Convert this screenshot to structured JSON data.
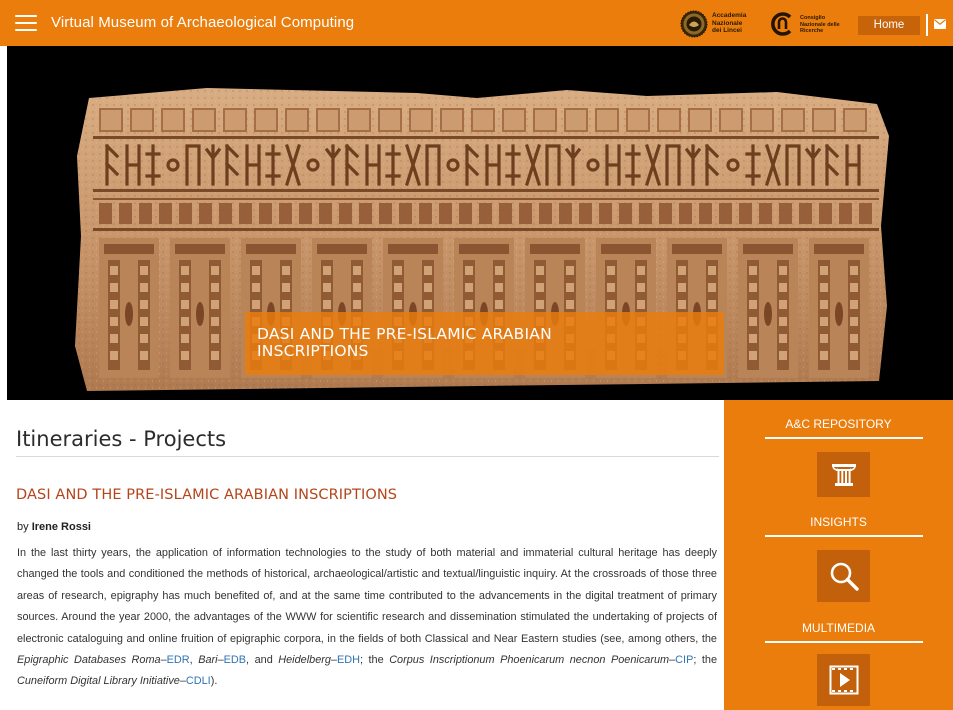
{
  "header": {
    "menu_icon": "hamburger-menu-icon",
    "title": "Virtual Museum of Archaeological Computing",
    "lincei_logo_text": [
      "Accademia",
      "Nazionale",
      "dei Lincei"
    ],
    "cnr_logo_text": [
      "Consiglio",
      "Nazionale delle",
      "Ricerche"
    ],
    "home_label": "Home",
    "mail_icon": "envelope-icon"
  },
  "hero": {
    "image": "carved stone slab with South Arabian inscription",
    "caption_lines": [
      "DASI AND THE PRE-ISLAMIC ARABIAN",
      "INSCRIPTIONS"
    ]
  },
  "main": {
    "page_title": "Itineraries - Projects",
    "article_title": "DASI AND THE PRE-ISLAMIC ARABIAN INSCRIPTIONS",
    "byline_prefix": "by",
    "author": "Irene Rossi",
    "body": {
      "t1": "In the last thirty years, the application of information technologies to the study of both material and immaterial cultural heritage has deeply changed the tools and conditioned the methods of historical, archaeological/artistic and textual/linguistic inquiry. At the crossroads of those three areas of research, epigraphy has much benefited of, and at the same time contributed to the advancements in the digital treatment of primary sources. Around the year 2000, the advantages of the WWW for scientific research and dissemination stimulated the undertaking of projects of electronic cataloguing and online fruition of epigraphic corpora, in the fields of both Classical and Near Eastern studies (see, among others, the ",
      "i1": "Epigraphic Databases Roma",
      "s1": "–",
      "l1": "EDR",
      "s2": ", ",
      "i2": "Bari",
      "s3": "–",
      "l2": "EDB",
      "s4": ", and ",
      "i3": "Heidelberg",
      "s5": "–",
      "l3": "EDH",
      "s6": "; the ",
      "i4": "Corpus Inscriptionum Phoenicarum necnon Poenicarum",
      "s7": "–",
      "l4": "CIP",
      "s8": "; the ",
      "i5": "Cuneiform Digital Library Initiative",
      "s9": "–",
      "l5": "CDLI",
      "s10": ")."
    }
  },
  "sidebar": {
    "sections": [
      {
        "label": "A&C REPOSITORY",
        "icon": "column-icon"
      },
      {
        "label": "INSIGHTS",
        "icon": "magnifier-icon"
      },
      {
        "label": "MULTIMEDIA",
        "icon": "video-play-icon"
      }
    ]
  },
  "colors": {
    "brand_orange": "#ea7d0c",
    "dark_orange": "#c7640a",
    "article_title": "#b5451a",
    "link": "#2f74b5"
  }
}
